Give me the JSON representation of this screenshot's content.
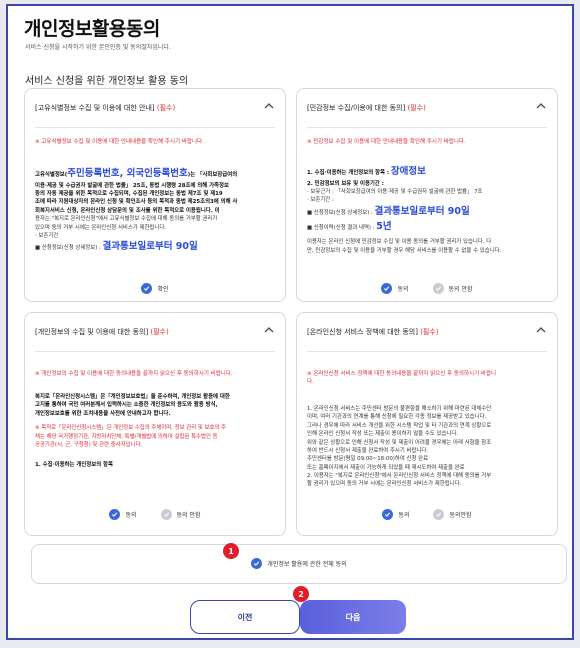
{
  "page": {
    "title": "개인정보활용동의",
    "subtitle": "서비스 신청을 시작하기 위한 본인인증 및 동의절차입니다.",
    "section_title": "서비스 신청을 위한 개인정보 활용 동의"
  },
  "card1": {
    "title": "[고유식별정보 수집 및 이용에 대한 안내]",
    "req": "(필수)",
    "notice": "※ 고유식별정보 수집 및 이용에 대한 안내내용을 확인해 주시기 바랍니다.",
    "p1a": "고유식별정보(",
    "p1big": "주민등록번호, 외국인등록번호",
    "p1b": ")는 「사회보장급여의",
    "p2": "이용·제공 및 수급권자 발굴에 관한 법률」 25조, 동법 시행령 28조에 의해 가족정보",
    "p3": "등의 자동 제공을 위한 목적으로 수집되며, 수집된 개인정보는 동법 제7조 및 제19",
    "p4": "조에 따라 지원대상자의 온라인 신청 및 확인조사 등의 목적과 동법 제25조의3에 의해 사",
    "p5": "회복지서비스 신청, 온라인신청 상담문의 및 조사를 위한 목적으로 이용됩니다. 이",
    "p6": "용자는 \"복지로 온라인신청\"에서 고유식별정보 수집에 대해 동의를 거부할 권리가",
    "p7": "있으며 동의 거부 시에는 온라인신청 서비스가 제한됩니다.",
    "p8": "· 보존기간",
    "p9a": "■ 신청정보(신청 상세정보) : ",
    "p9big": "결과통보일로부터 90일",
    "confirm": "확인"
  },
  "card2": {
    "title": "[민감정보 수집/이용에 대한 동의]",
    "req": "(필수)",
    "notice": "※ 민감정보 수집 및 이용에 대한 안내내용을 확인해 주시기 바랍니다.",
    "l1a": "1. 수집·이용하는 개인정보의 항목 : ",
    "l1big": "장애정보",
    "l2": "2. 민감정보의 보유 및 이용기간 :",
    "l3": "· 보유근거 : 「사회보장급여의 이용·제공 및 수급권자 발굴에 관한 법률」 7조",
    "l4": "· 보존기간 :",
    "l5a": "■ 신청정보(신청 상세정보) : ",
    "l5big": "결과통보일로부터 90일",
    "l6a": "■ 신청이력(신청 결과 내역) : ",
    "l6big": "5년",
    "l7": "이용자는 온라인 신청에 민감정보 수집 및 이용 동의를 거부할 권리가 있습니다. 다",
    "l8": "만, 민감정보의 수집 및 이용을 거부할 경우 해당 서비스를 이용할 수 없을 수 있습니다.",
    "agree": "동의",
    "disagree": "동의 안함"
  },
  "card3": {
    "title": "[개인정보의 수집 및 이용에 대한 동의]",
    "req": "(필수)",
    "notice": "※ 개인정보의 수집 및 이용에 대한 동의내용을 끝까지 읽으신 후 동의하시기 바랍니다.",
    "b1": "복지로「온라인신청시스템」은「개인정보보호법」을 준수하며, 개인정보 활용에 대한",
    "b2": "고지를 통하여 국민 여러분께서 입력하시는 소중한 개인정보의 용도와 활용 방식,",
    "b3": "개인정보보호를 위한 조치내용을 사전에 안내하고자 합니다.",
    "r1": "※ 목적로「온라인신청시스템」은 개인정보 수집의 주체이며, 정보 관리 및 보호의 주",
    "r2": "체는 해당 국가행정기관, 지방자치단체, 특별/개별법에 의하여 설립된 특수법인 등",
    "r3": "공공기관(시, 군, 구청청) 및 관련 중사자입니다.",
    "s1": "1. 수집·이용하는 개인정보의 항목",
    "agree": "동의",
    "disagree": "동의 안함"
  },
  "card4": {
    "title": "[온라인신청 서비스 정책에 대한 동의]",
    "req": "(필수)",
    "notice1": "※ 온라인신청 서비스 정책에 대한 동의내용을 끝까지 읽으신 후 동의하시기 바랍니",
    "notice2": "다.",
    "t1": "1. 온라인신청 서비스는 주민센터 방문의 불편함을 해소하기 위해 마련된 대체수단",
    "t2": "이며, 여러 기관과의 연계를 통해 신청에 필요한 각종 정보를 제공받고 있습니다.",
    "t3": "그러나 경우에 따라 서비스 개선을 위한 시스템 작업 및 타 기관과의 연계 상황으로",
    "t4": "인해 온라인 신청서 작성 또는 제출이 용이하지 않을 수도 있습니다.",
    "t5": "위와 같은 상황으로 인해 신청서 작성 및 제출이 어려울 경우에는 아래 사항을 참조",
    "t6": "하여 반드시 신청서 제출을 완료하여 주시기 바랍니다.",
    "t7": "주민센터를 방문(평일 09:00~18:00)하여 신청 완료",
    "t8": "또는 홈페이지에서 제출이 가능하게 되었을 때 재시도하여 제출을 완료",
    "t9": "2. 이용자는 \"복지로 온라인신청\"에서 온라인신청 서비스 정책에 대해 동의를 거부",
    "t10": "할 권리가 있으며 동의 거부 시에는 온라인신청 서비스가 제한됩니다.",
    "agree": "동의",
    "disagree": "동의안함"
  },
  "agree_all": {
    "label": "개인정보 활용에 관한 전체 동의",
    "badge": "1"
  },
  "buttons": {
    "prev": "이전",
    "next": "다음",
    "next_badge": "2"
  },
  "colors": {
    "accent": "#3b6ad8",
    "required": "#e0262c",
    "frame": "#3b47a8",
    "badge": "#e31b2a"
  }
}
